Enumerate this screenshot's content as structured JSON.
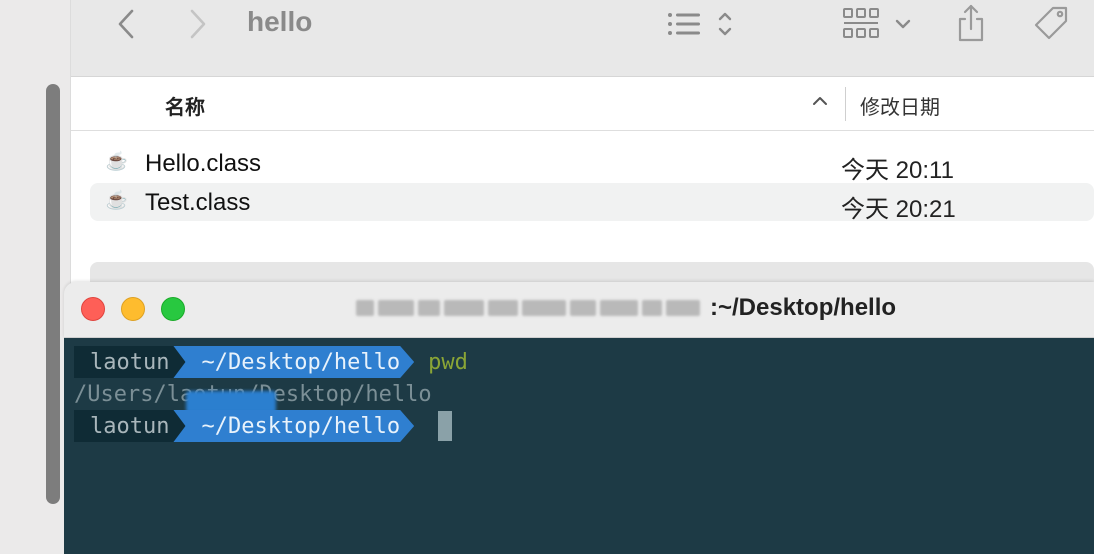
{
  "finder": {
    "title": "hello",
    "columns": {
      "name": "名称",
      "date": "修改日期"
    },
    "files": [
      {
        "name": "Hello.class",
        "date": "今天 20:11",
        "icon": "java-class-file-icon"
      },
      {
        "name": "Test.class",
        "date": "今天 20:21",
        "icon": "java-class-file-icon"
      }
    ]
  },
  "terminal": {
    "title_suffix": ":~/Desktop/hello",
    "prompt_user": "laotun",
    "prompt_path": "~/Desktop/hello",
    "command": "pwd",
    "output": "/Users/laotun/Desktop/hello"
  },
  "colors": {
    "terminal_bg": "#1d3a45",
    "prompt_path_bg": "#2f7fd0",
    "command_text": "#8aa536"
  }
}
